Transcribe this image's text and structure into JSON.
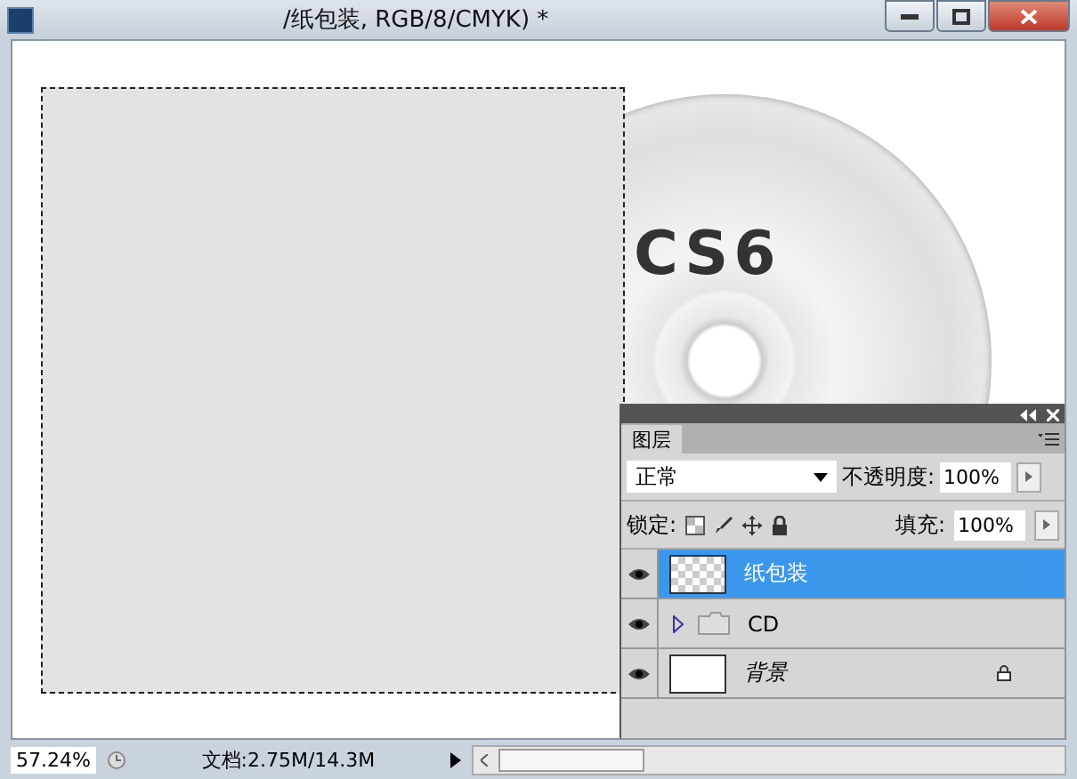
{
  "window": {
    "title": "/纸包装, RGB/8/CMYK) *"
  },
  "canvas": {
    "artwork_text": "CS6"
  },
  "layers_panel": {
    "tab": "图层",
    "blend_mode": "正常",
    "opacity_label": "不透明度:",
    "opacity": "100%",
    "lock_label": "锁定:",
    "fill_label": "填充:",
    "fill": "100%",
    "layers": [
      {
        "kind": "layer",
        "name": "纸包装",
        "visible": true,
        "selected": true,
        "locked": false
      },
      {
        "kind": "group",
        "name": "CD",
        "visible": true,
        "selected": false,
        "locked": false
      },
      {
        "kind": "background",
        "name": "背景",
        "visible": true,
        "selected": false,
        "locked": true
      }
    ]
  },
  "status_bar": {
    "zoom": "57.24%",
    "doc_info": "文档:2.75M/14.3M"
  }
}
